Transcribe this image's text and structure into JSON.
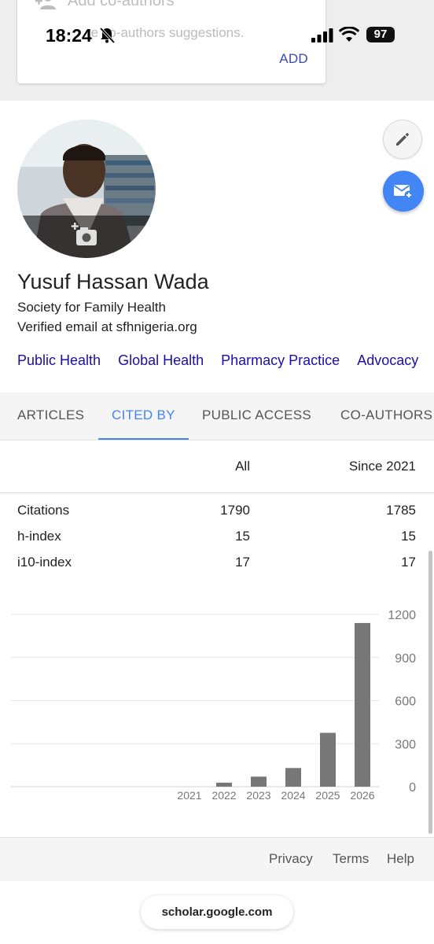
{
  "status_bar": {
    "time": "18:24",
    "battery": "97"
  },
  "coauthors_card": {
    "title": "Add co-authors",
    "suggestions_text": "re co-authors suggestions.",
    "add_label": "ADD"
  },
  "profile": {
    "name": "Yusuf Hassan Wada",
    "affiliation": "Society for Family Health",
    "email": "Verified email at sfhnigeria.org",
    "interests": [
      "Public Health",
      "Global Health",
      "Pharmacy Practice",
      "Advocacy"
    ]
  },
  "tabs": [
    {
      "label": "ARTICLES",
      "active": false
    },
    {
      "label": "CITED BY",
      "active": true
    },
    {
      "label": "PUBLIC ACCESS",
      "active": false
    },
    {
      "label": "CO-AUTHORS",
      "active": false
    }
  ],
  "citations_table": {
    "headers": {
      "all": "All",
      "since": "Since 2021"
    },
    "rows": [
      {
        "label": "Citations",
        "all": "1790",
        "since": "1785"
      },
      {
        "label": "h-index",
        "all": "15",
        "since": "15"
      },
      {
        "label": "i10-index",
        "all": "17",
        "since": "17"
      }
    ]
  },
  "chart_data": {
    "type": "bar",
    "title": "",
    "xlabel": "",
    "ylabel": "",
    "categories": [
      "2021",
      "2022",
      "2023",
      "2024",
      "2025",
      "2026"
    ],
    "values": [
      0,
      28,
      70,
      130,
      375,
      1140
    ],
    "ylim": [
      0,
      1200
    ],
    "yticks": [
      0,
      300,
      600,
      900,
      1200
    ],
    "bar_color": "#777777",
    "grid": true
  },
  "footer": {
    "privacy": "Privacy",
    "terms": "Terms",
    "help": "Help"
  },
  "browser": {
    "url": "scholar.google.com"
  },
  "colors": {
    "accent": "#4285f4",
    "link": "#1a0dab",
    "add": "#3949ab"
  }
}
